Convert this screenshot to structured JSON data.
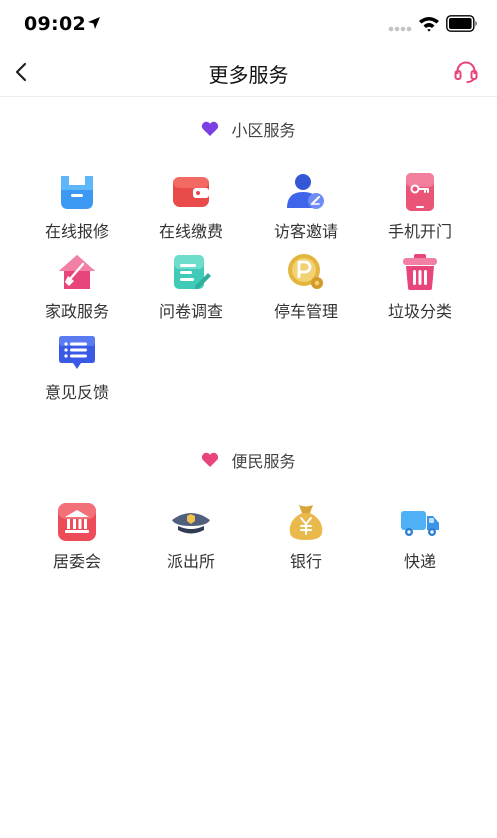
{
  "status_bar": {
    "time": "09:02"
  },
  "nav": {
    "title": "更多服务"
  },
  "sections": [
    {
      "title": "小区服务",
      "items": [
        {
          "label": "在线报修",
          "icon": "repair-icon"
        },
        {
          "label": "在线缴费",
          "icon": "wallet-icon"
        },
        {
          "label": "访客邀请",
          "icon": "visitor-icon"
        },
        {
          "label": "手机开门",
          "icon": "phone-key-icon"
        },
        {
          "label": "家政服务",
          "icon": "housekeeping-icon"
        },
        {
          "label": "问卷调查",
          "icon": "survey-icon"
        },
        {
          "label": "停车管理",
          "icon": "parking-icon"
        },
        {
          "label": "垃圾分类",
          "icon": "trash-icon"
        },
        {
          "label": "意见反馈",
          "icon": "feedback-icon"
        }
      ]
    },
    {
      "title": "便民服务",
      "items": [
        {
          "label": "居委会",
          "icon": "committee-icon"
        },
        {
          "label": "派出所",
          "icon": "police-icon"
        },
        {
          "label": "银行",
          "icon": "bank-icon"
        },
        {
          "label": "快递",
          "icon": "delivery-icon"
        }
      ]
    }
  ],
  "colors": {
    "accent_pink": "#e8457a",
    "heart_purple": "#7b3fe4",
    "heart_pink": "#e8457a"
  }
}
